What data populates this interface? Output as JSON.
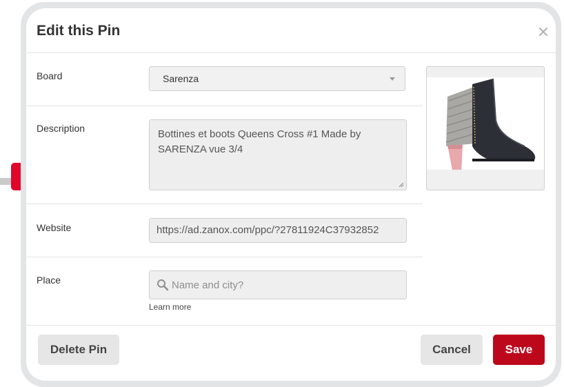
{
  "modal": {
    "title": "Edit this Pin",
    "close_icon": "close-icon"
  },
  "board": {
    "label": "Board",
    "selected": "Sarenza",
    "dropdown_icon": "caret-down-icon"
  },
  "description": {
    "label": "Description",
    "value": "Bottines et boots Queens Cross #1 Made by SARENZA vue 3/4"
  },
  "website": {
    "label": "Website",
    "value": "https://ad.zanox.com/ppc/?27811924C37932852"
  },
  "place": {
    "label": "Place",
    "placeholder": "Name and city?",
    "search_icon": "search-icon",
    "learn_more": "Learn more"
  },
  "pin_image": {
    "subject": "black ankle boot with grey panel and pink block heel"
  },
  "footer": {
    "delete_label": "Delete Pin",
    "cancel_label": "Cancel",
    "save_label": "Save"
  },
  "colors": {
    "save_button": "#bd081c",
    "side_marker": "#e0052b",
    "frame": "#e2e4e6"
  }
}
